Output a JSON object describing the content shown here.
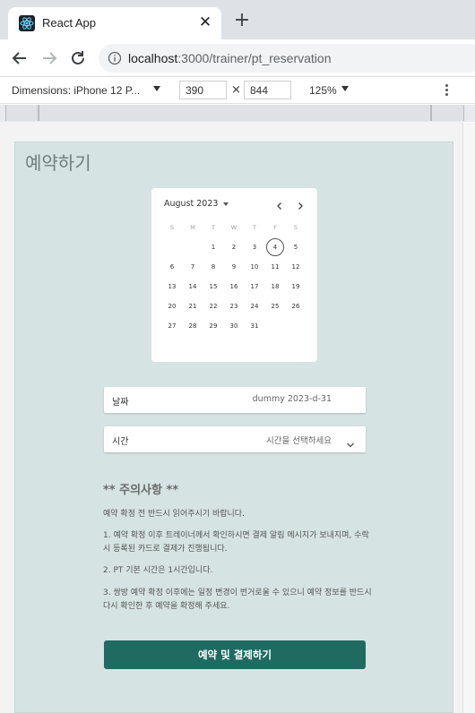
{
  "browser": {
    "tab_title": "React App",
    "tab_close": "✕",
    "new_tab": "+",
    "url_host": "localhost",
    "url_rest": ":3000/trainer/pt_reservation"
  },
  "devtools": {
    "device": "Dimensions: iPhone 12 P...",
    "width": "390",
    "times": "×",
    "height": "844",
    "zoom": "125%"
  },
  "page": {
    "title": "예약하기",
    "calendar": {
      "month_label": "August 2023",
      "weekdays": [
        "S",
        "M",
        "T",
        "W",
        "T",
        "F",
        "S"
      ],
      "weeks": [
        [
          "",
          "",
          "1",
          "2",
          "3",
          "4",
          "5"
        ],
        [
          "6",
          "7",
          "8",
          "9",
          "10",
          "11",
          "12"
        ],
        [
          "13",
          "14",
          "15",
          "16",
          "17",
          "18",
          "19"
        ],
        [
          "20",
          "21",
          "22",
          "23",
          "24",
          "25",
          "26"
        ],
        [
          "27",
          "28",
          "29",
          "30",
          "31",
          "",
          ""
        ]
      ],
      "today": "4"
    },
    "date_field": {
      "label": "날짜",
      "value": "dummy 2023-d-31"
    },
    "time_field": {
      "label": "시간",
      "placeholder": "시간을 선택하세요"
    },
    "notice": {
      "title": "** 주의사항 **",
      "line0": "예약 확정 전 반드시 읽어주시기 바랍니다.",
      "line1": "1. 예약 확정 이후 트레이너께서 확인하시면 결제 알림 메시지가 보내지며, 수락 시 등록된 카드로 결제가 진행됩니다.",
      "line2": "2. PT 기본 시간은 1시간입니다.",
      "line3": "3. 쌍방 예약 확정 이후에는 일정 변경이 번거로울 수 있으니 예약 정보를 반드시 다시 확인한 후 예약을 확정해 주세요."
    },
    "submit_label": "예약 및 결제하기"
  },
  "colors": {
    "accent": "#1f6b62",
    "page_bg": "#d5e3e2"
  }
}
